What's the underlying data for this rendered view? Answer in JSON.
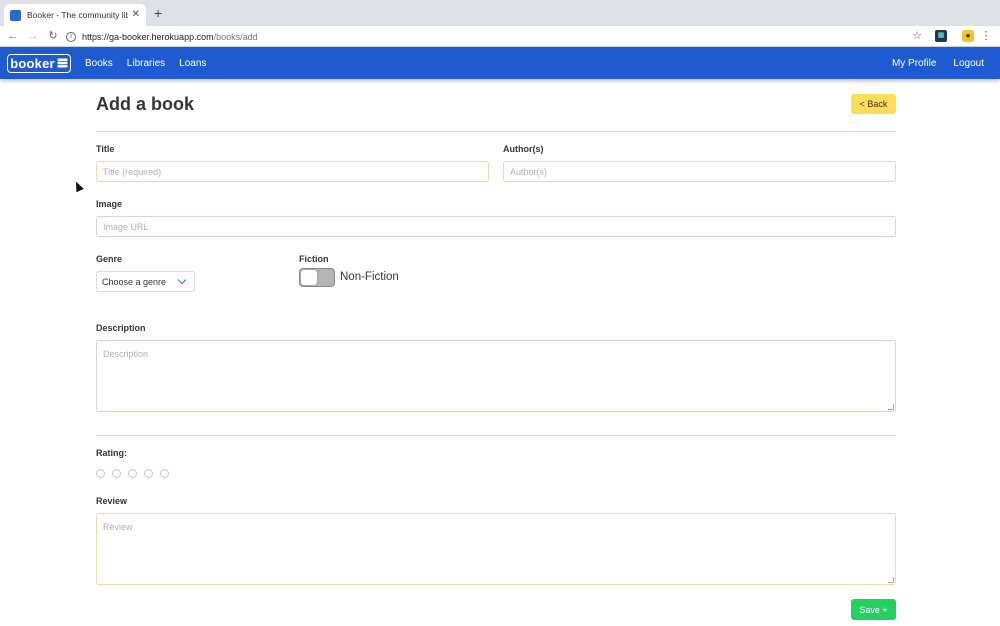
{
  "browser": {
    "tab_title": "Booker - The community librar",
    "tab_close": "✕",
    "new_tab": "+",
    "url_host": "https://ga-booker.herokuapp.com",
    "url_path": "/books/add",
    "icons": [
      "back-arrow-icon",
      "forward-arrow-icon",
      "reload-icon",
      "info-icon",
      "star-bookmark-icon",
      "extension-icon",
      "menu-kebab-icon"
    ]
  },
  "navbar": {
    "brand": "booker",
    "links": [
      "Books",
      "Libraries",
      "Loans"
    ],
    "right_links": [
      "My Profile",
      "Logout"
    ],
    "color": "#1e5bd0"
  },
  "page": {
    "title": "Add a book",
    "back_label": "< Back"
  },
  "form": {
    "title_label": "Title",
    "title_placeholder": "Title (required)",
    "author_label": "Author(s)",
    "author_placeholder": "Author(s)",
    "image_label": "Image",
    "image_placeholder": "Image URL",
    "genre_label": "Genre",
    "genre_value": "Choose a genre",
    "fiction_label": "Fiction",
    "fiction_state": "Non-Fiction",
    "fiction_on": false,
    "description_label": "Description",
    "description_placeholder": "Description",
    "rating_label": "Rating:",
    "rating_value": 0,
    "rating_max": 5,
    "review_label": "Review",
    "review_placeholder": "Review",
    "save_label": "Save +"
  },
  "colors": {
    "back_button": "#ffdd57",
    "save_button": "#23d160"
  }
}
